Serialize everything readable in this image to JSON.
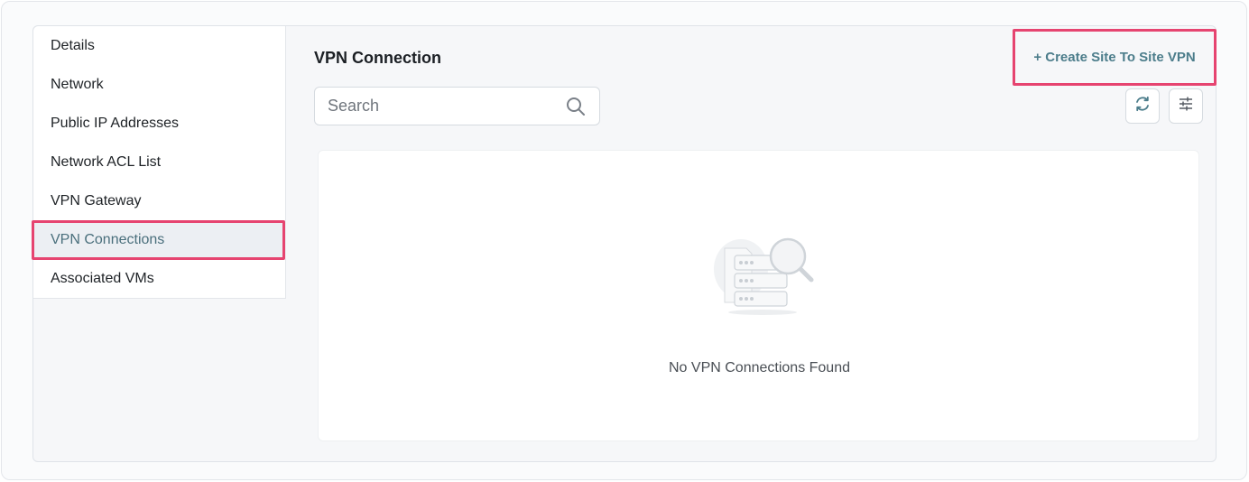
{
  "sidebar": {
    "items": [
      {
        "label": "Details"
      },
      {
        "label": "Network"
      },
      {
        "label": "Public IP Addresses"
      },
      {
        "label": "Network ACL List"
      },
      {
        "label": "VPN Gateway"
      },
      {
        "label": "VPN Connections",
        "active": true
      },
      {
        "label": "Associated VMs"
      }
    ]
  },
  "main": {
    "title": "VPN Connection",
    "create_button_label": "+ Create Site To Site VPN",
    "search": {
      "placeholder": "Search",
      "value": ""
    },
    "refresh_icon": "refresh-icon",
    "filter_icon": "sliders-icon",
    "empty_state": {
      "icon": "server-search-icon",
      "message": "No VPN Connections Found"
    }
  },
  "colors": {
    "accent": "#4c7d8b",
    "highlight": "#e64470",
    "active_bg": "#eceff3"
  }
}
